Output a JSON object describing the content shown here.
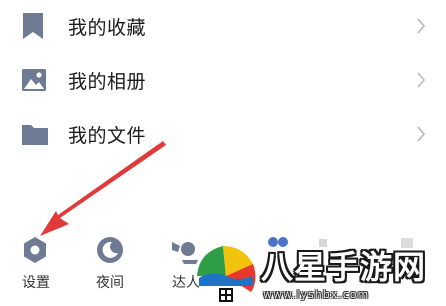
{
  "menu": {
    "items": [
      {
        "label": "我的收藏",
        "icon": "bookmark-icon"
      },
      {
        "label": "我的相册",
        "icon": "image-icon"
      },
      {
        "label": "我的文件",
        "icon": "folder-icon"
      }
    ]
  },
  "bottom_bar": {
    "settings_label": "设置",
    "night_label": "夜间",
    "expert_label": "达人"
  },
  "watermark": {
    "title": "八星手游网",
    "url": "www.lyshbx.com"
  },
  "colors": {
    "icon": "#6f7a94",
    "arrow": "#e03a3a",
    "chevron": "#b9b9b9"
  }
}
